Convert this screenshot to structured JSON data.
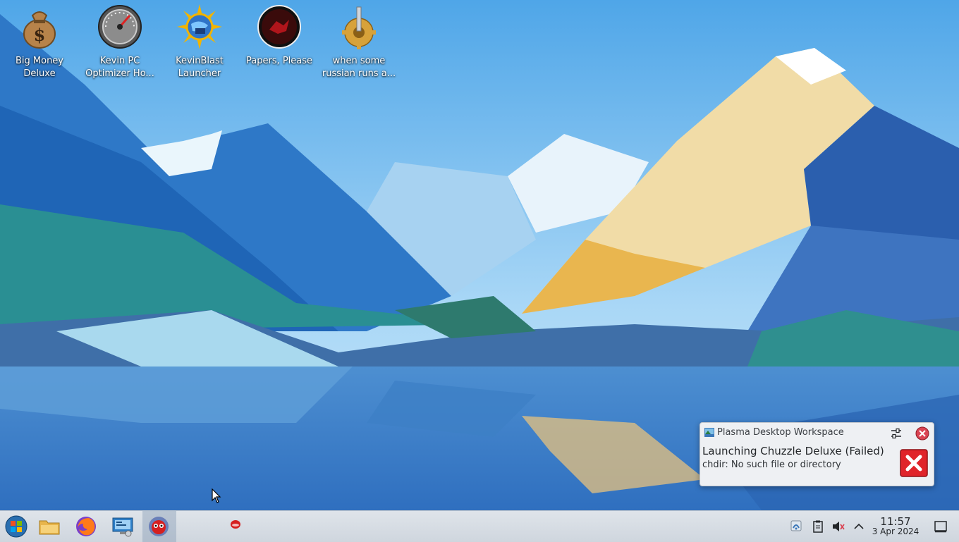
{
  "desktop": {
    "icons": [
      {
        "label": "Big Money\nDeluxe",
        "icon": "money-bag-icon"
      },
      {
        "label": "Kevin PC\nOptimizer Ho...",
        "icon": "speedometer-icon"
      },
      {
        "label": "KevinBlast\nLauncher",
        "icon": "sun-globe-icon"
      },
      {
        "label": "Papers, Please",
        "icon": "papers-please-seal-icon"
      },
      {
        "label": "when some\nrussian runs a...",
        "icon": "gear-joystick-icon"
      }
    ]
  },
  "notification": {
    "app_name": "Plasma Desktop Workspace",
    "title": "Launching Chuzzle Deluxe (Failed)",
    "body": "chdir: No such file or directory",
    "icons": {
      "app": "plasma-icon",
      "configure": "configure-icon",
      "close": "close-icon",
      "error": "error-icon"
    },
    "error_color": "#e0242a"
  },
  "taskbar": {
    "launchers": [
      {
        "name": "start-menu",
        "icon": "start-orb-icon"
      },
      {
        "name": "file-manager",
        "icon": "folder-icon"
      },
      {
        "name": "firefox",
        "icon": "firefox-icon"
      },
      {
        "name": "system-settings",
        "icon": "monitor-settings-icon"
      },
      {
        "name": "chuzzle",
        "icon": "chuzzle-icon"
      }
    ],
    "tray": [
      "network-icon",
      "clipboard-icon",
      "volume-muted-icon",
      "chevron-up-icon",
      "show-desktop-icon"
    ],
    "clock": {
      "time": "11:57",
      "date": "3 Apr 2024"
    }
  }
}
